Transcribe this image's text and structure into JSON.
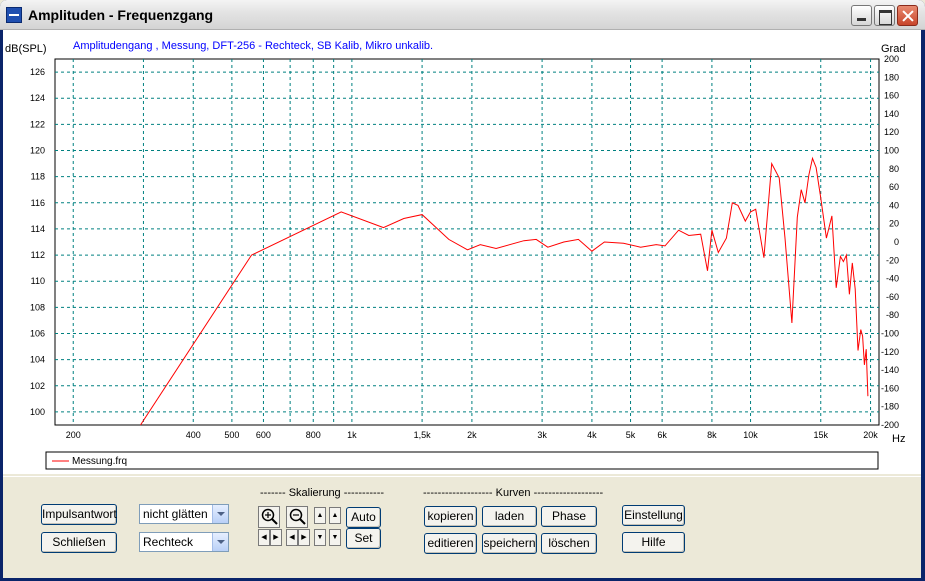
{
  "window": {
    "title": "Amplituden - Frequenzgang"
  },
  "chart_data": {
    "type": "line",
    "title": "Amplitudengang , Messung, DFT-256 - Rechteck, SB Kalib, Mikro unkalib.",
    "ylabel": "dB(SPL)",
    "y2label": "Grad",
    "xunit": "Hz",
    "xscale": "log",
    "xlim": [
      180,
      21000
    ],
    "ylim": [
      99,
      127
    ],
    "y2lim": [
      -200,
      200
    ],
    "yticks": [
      100,
      102,
      104,
      106,
      108,
      110,
      112,
      114,
      116,
      118,
      120,
      122,
      124,
      126
    ],
    "y2ticks": [
      -200,
      -180,
      -160,
      -140,
      -120,
      -100,
      -80,
      -60,
      -40,
      -20,
      0,
      20,
      40,
      60,
      80,
      100,
      120,
      140,
      160,
      180,
      200
    ],
    "xticks": [
      {
        "v": 200,
        "label": "200"
      },
      {
        "v": 400,
        "label": "400"
      },
      {
        "v": 500,
        "label": "500"
      },
      {
        "v": 600,
        "label": "600"
      },
      {
        "v": 800,
        "label": "800"
      },
      {
        "v": 1000,
        "label": "1k"
      },
      {
        "v": 1500,
        "label": "1,5k"
      },
      {
        "v": 2000,
        "label": "2k"
      },
      {
        "v": 3000,
        "label": "3k"
      },
      {
        "v": 4000,
        "label": "4k"
      },
      {
        "v": 5000,
        "label": "5k"
      },
      {
        "v": 6000,
        "label": "6k"
      },
      {
        "v": 8000,
        "label": "8k"
      },
      {
        "v": 10000,
        "label": "10k"
      },
      {
        "v": 15000,
        "label": "15k"
      },
      {
        "v": 20000,
        "label": "20k"
      }
    ],
    "xgrid_extra": [
      300,
      700,
      900
    ],
    "grid": true,
    "legend_position": "bottom",
    "series": [
      {
        "name": "Messung.frq",
        "color": "#ff0000",
        "x": [
          295,
          560,
          940,
          1200,
          1350,
          1500,
          1750,
          1950,
          2100,
          2300,
          2700,
          2900,
          3100,
          3400,
          3700,
          4000,
          4300,
          4800,
          5300,
          5800,
          6100,
          6600,
          7000,
          7500,
          7800,
          8000,
          8300,
          8700,
          9000,
          9300,
          9700,
          10000,
          10300,
          10800,
          11300,
          11800,
          12200,
          12700,
          13100,
          13400,
          13700,
          14000,
          14300,
          14600,
          15000,
          15500,
          16000,
          16400,
          16800,
          17100,
          17400,
          17700,
          18000,
          18300,
          18600,
          18900,
          19100,
          19300,
          19500,
          19700
        ],
        "values": [
          98.5,
          112.0,
          115.3,
          114.1,
          114.8,
          115.1,
          113.2,
          112.4,
          112.8,
          112.5,
          113.1,
          113.2,
          112.6,
          113.0,
          113.2,
          112.3,
          113.0,
          112.9,
          112.6,
          112.8,
          112.7,
          113.9,
          113.5,
          113.6,
          110.8,
          113.9,
          112.2,
          113.3,
          116.0,
          115.8,
          114.6,
          115.3,
          115.5,
          111.8,
          119.0,
          117.9,
          113.3,
          106.8,
          114.9,
          117.0,
          116.0,
          118.1,
          119.4,
          118.7,
          116.4,
          113.3,
          115.0,
          109.5,
          111.9,
          111.5,
          112.0,
          109.0,
          111.4,
          109.4,
          104.7,
          106.3,
          105.8,
          103.6,
          104.8,
          101.2
        ]
      }
    ]
  },
  "controls": {
    "impulse_button": "Impulsantwort",
    "close_button": "Schließen",
    "smoothing_select": "nicht glätten",
    "window_select": "Rechteck",
    "scaling_label": "------- Skalierung -----------",
    "curves_label": "------------------- Kurven -------------------",
    "auto_button": "Auto",
    "set_button": "Set",
    "copy_button": "kopieren",
    "load_button": "laden",
    "phase_button": "Phase",
    "edit_button": "editieren",
    "save_button": "speichern",
    "delete_button": "löschen",
    "settings_button": "Einstellung",
    "help_button": "Hilfe"
  }
}
